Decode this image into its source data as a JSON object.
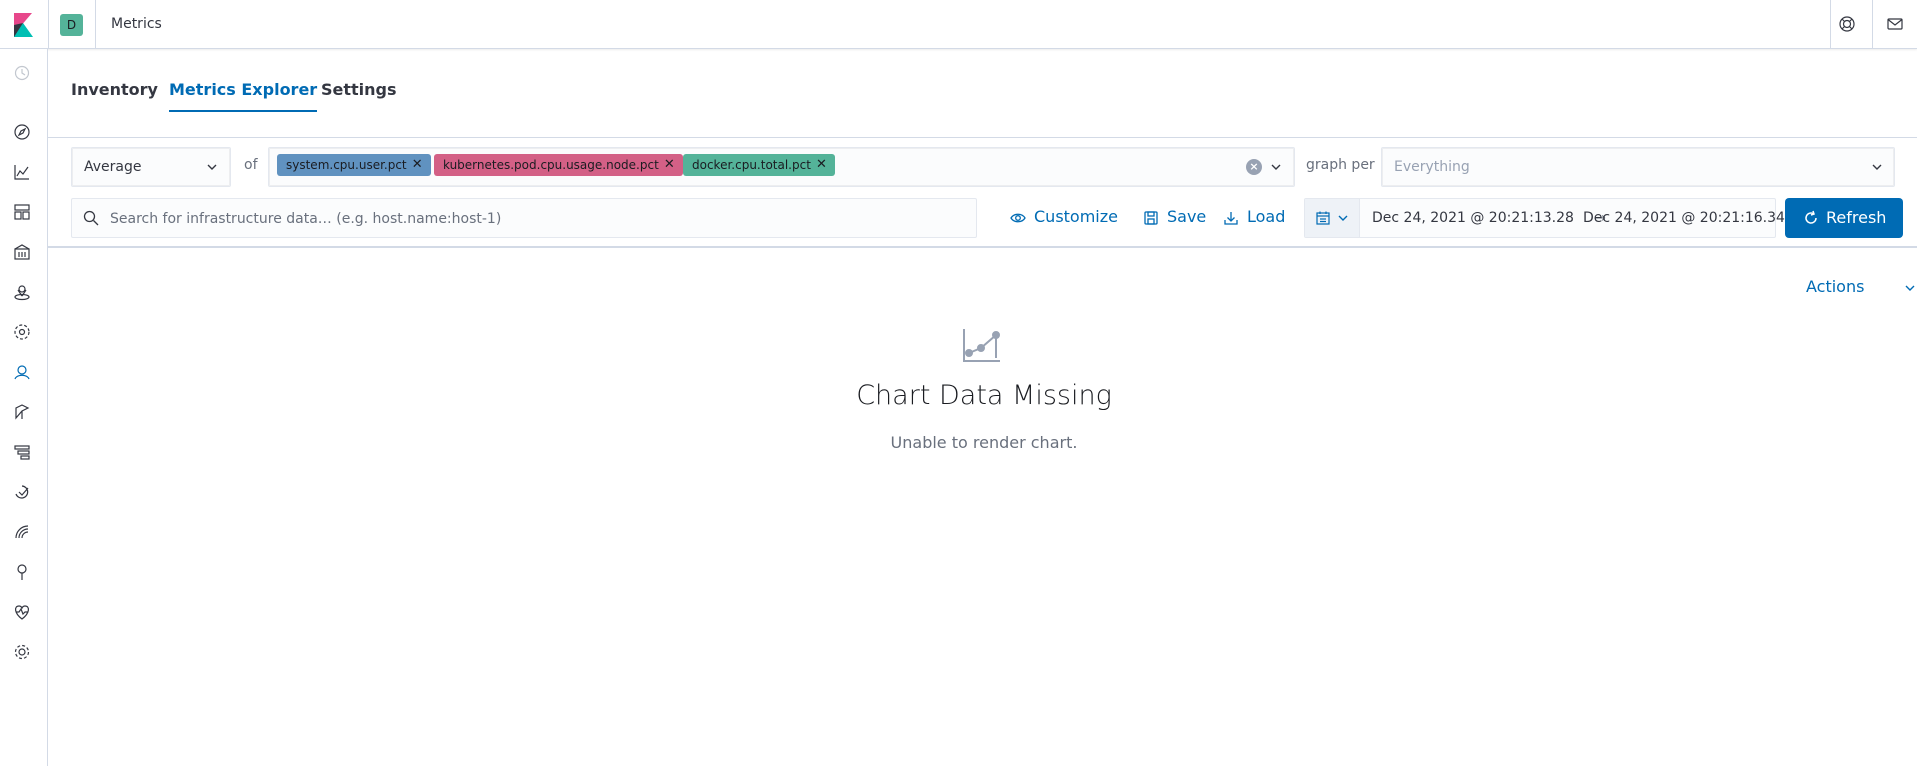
{
  "header": {
    "space_initial": "D",
    "app_title": "Metrics"
  },
  "tabs": [
    {
      "label": "Inventory"
    },
    {
      "label": "Metrics Explorer"
    },
    {
      "label": "Settings"
    }
  ],
  "controls": {
    "aggregation_value": "Average",
    "of_label": "of",
    "metrics": [
      {
        "label": "system.cpu.user.pct",
        "color": "#6092c0"
      },
      {
        "label": "kubernetes.pod.cpu.usage.node.pct",
        "color": "#d36086"
      },
      {
        "label": "docker.cpu.total.pct",
        "color": "#54b399"
      }
    ],
    "graph_per_label": "graph per",
    "graph_per_placeholder": "Everything",
    "search_placeholder": "Search for infrastructure data… (e.g. host.name:host-1)",
    "customize_label": "Customize",
    "save_label": "Save",
    "load_label": "Load",
    "date_start": "Dec 24, 2021 @ 20:21:13.28",
    "date_end": "Dec 24, 2021 @ 20:21:16.34",
    "date_arrow": "→",
    "refresh_label": "Refresh"
  },
  "content": {
    "actions_label": "Actions",
    "empty_title": "Chart Data Missing",
    "empty_body": "Unable to render chart."
  },
  "colors": {
    "accent": "#006bb4",
    "space_badge": "#54b399"
  }
}
